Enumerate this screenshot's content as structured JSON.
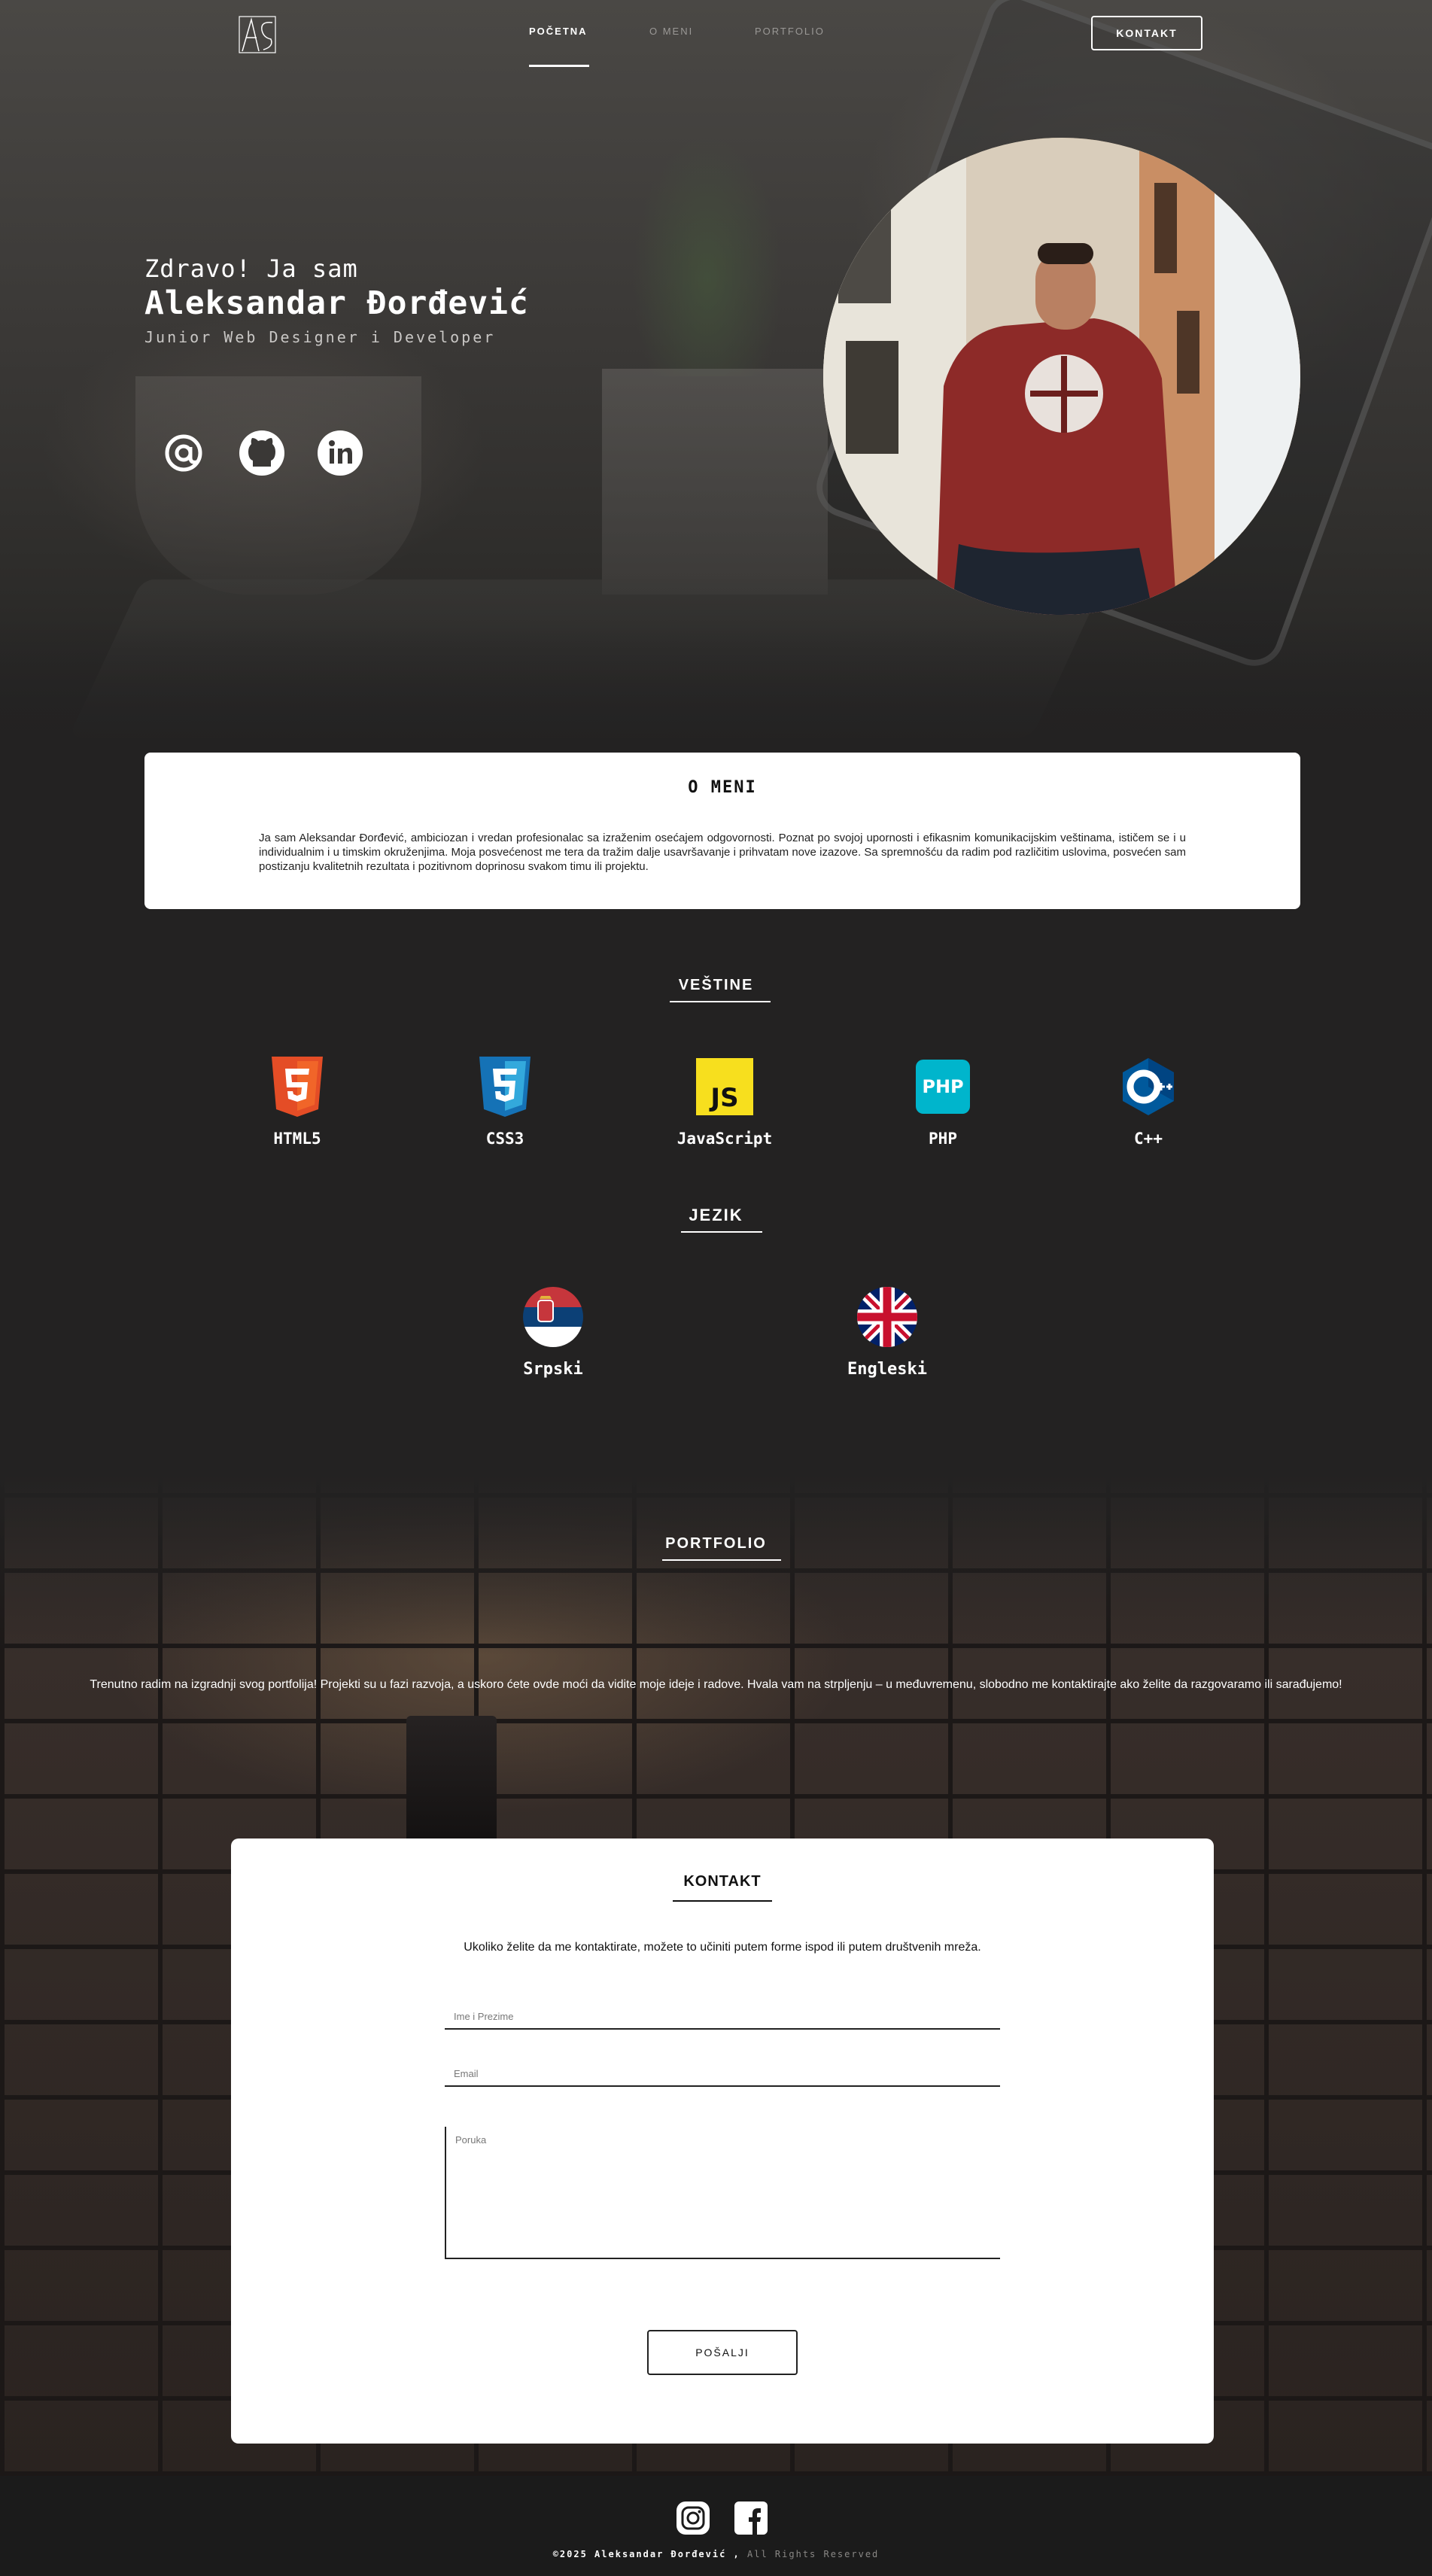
{
  "nav": {
    "items": [
      {
        "label": "POČETNA",
        "active": true
      },
      {
        "label": "O MENI",
        "active": false
      },
      {
        "label": "PORTFOLIO",
        "active": false
      }
    ],
    "cta": "KONTAKT",
    "logo_icon": "as-monogram-logo"
  },
  "hero": {
    "greeting": "Zdravo! Ja sam",
    "name": "Aleksandar Đorđević",
    "role": "Junior Web Designer i Developer",
    "social_icons": [
      "at-sign-icon",
      "github-icon",
      "linkedin-icon"
    ]
  },
  "about": {
    "title": "O MENI",
    "text": "Ja sam Aleksandar Đorđević, ambiciozan i vredan profesionalac sa izraženim osećajem odgovornosti. Poznat po svojoj upornosti i efikasnim komunikacijskim veštinama, ističem se i u individualnim i u timskim okruženjima. Moja posvećenost me tera da tražim dalje usavršavanje i prihvatam nove izazove. Sa spremnošću da radim pod različitim uslovima, posvećen sam postizanju kvalitetnih rezultata i pozitivnom doprinosu svakom timu ili projektu."
  },
  "skills": {
    "title": "VEŠTINE",
    "items": [
      {
        "label": "HTML5",
        "icon": "html5-icon",
        "color": "#e44d26"
      },
      {
        "label": "CSS3",
        "icon": "css3-icon",
        "color": "#1572b6"
      },
      {
        "label": "JavaScript",
        "icon": "javascript-icon",
        "color": "#f7df1e"
      },
      {
        "label": "PHP",
        "icon": "php-icon",
        "color": "#00b5cc"
      },
      {
        "label": "C++",
        "icon": "cplusplus-icon",
        "color": "#00599c"
      }
    ]
  },
  "languages": {
    "title": "JEZIK",
    "items": [
      {
        "label": "Srpski",
        "icon": "serbia-flag-icon"
      },
      {
        "label": "Engleski",
        "icon": "uk-flag-icon"
      }
    ]
  },
  "portfolio": {
    "title": "PORTFOLIO",
    "text": "Trenutno radim na izgradnji svog portfolija! Projekti su u fazi razvoja, a uskoro ćete ovde moći da vidite moje ideje i radove. Hvala vam na strpljenju – u međuvremenu, slobodno me kontaktirajte ako želite da razgovaramo ili sarađujemo!"
  },
  "contact": {
    "title": "KONTAKT",
    "intro": "Ukoliko želite da me kontaktirate, možete to učiniti putem forme ispod ili putem društvenih mreža.",
    "name_placeholder": "Ime i Prezime",
    "email_placeholder": "Email",
    "message_placeholder": "Poruka",
    "submit": "POŠALJI"
  },
  "footer": {
    "copyright": "©2025 Aleksandar Đorđević ,",
    "rights": "All Rights Reserved",
    "icons": [
      "instagram-icon",
      "facebook-icon"
    ]
  }
}
